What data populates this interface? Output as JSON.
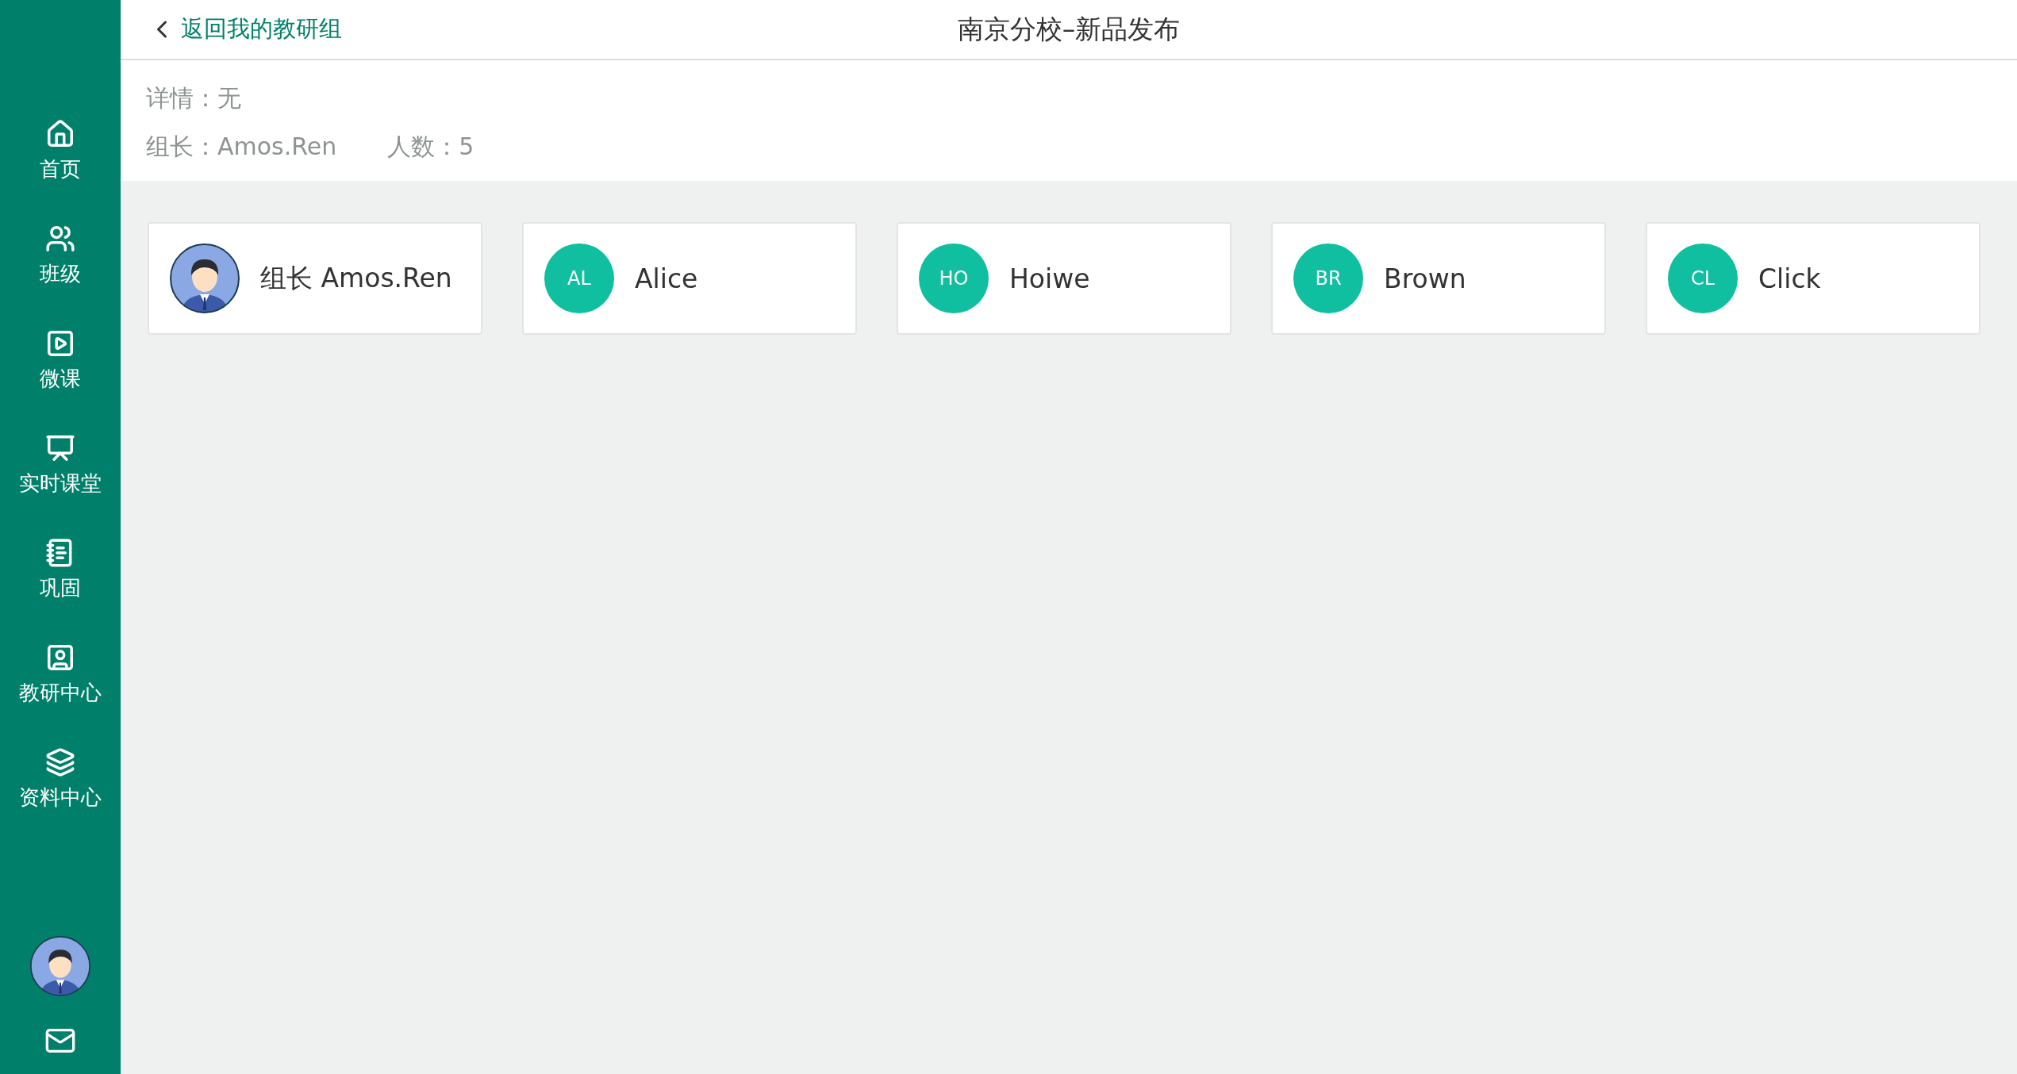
{
  "sidebar": {
    "items": [
      {
        "label": "首页"
      },
      {
        "label": "班级"
      },
      {
        "label": "微课"
      },
      {
        "label": "实时课堂"
      },
      {
        "label": "巩固"
      },
      {
        "label": "教研中心"
      },
      {
        "label": "资料中心"
      }
    ]
  },
  "header": {
    "back_link": "返回我的教研组",
    "title": "南京分校–新品发布"
  },
  "info": {
    "details": "详情：无",
    "leader": "组长：Amos.Ren",
    "count": "人数：5"
  },
  "members": [
    {
      "kind": "leader",
      "name": "组长 Amos.Ren"
    },
    {
      "kind": "member",
      "initials": "AL",
      "name": "Alice"
    },
    {
      "kind": "member",
      "initials": "HO",
      "name": "Hoiwe"
    },
    {
      "kind": "member",
      "initials": "BR",
      "name": "Brown"
    },
    {
      "kind": "member",
      "initials": "CL",
      "name": "Click"
    }
  ]
}
